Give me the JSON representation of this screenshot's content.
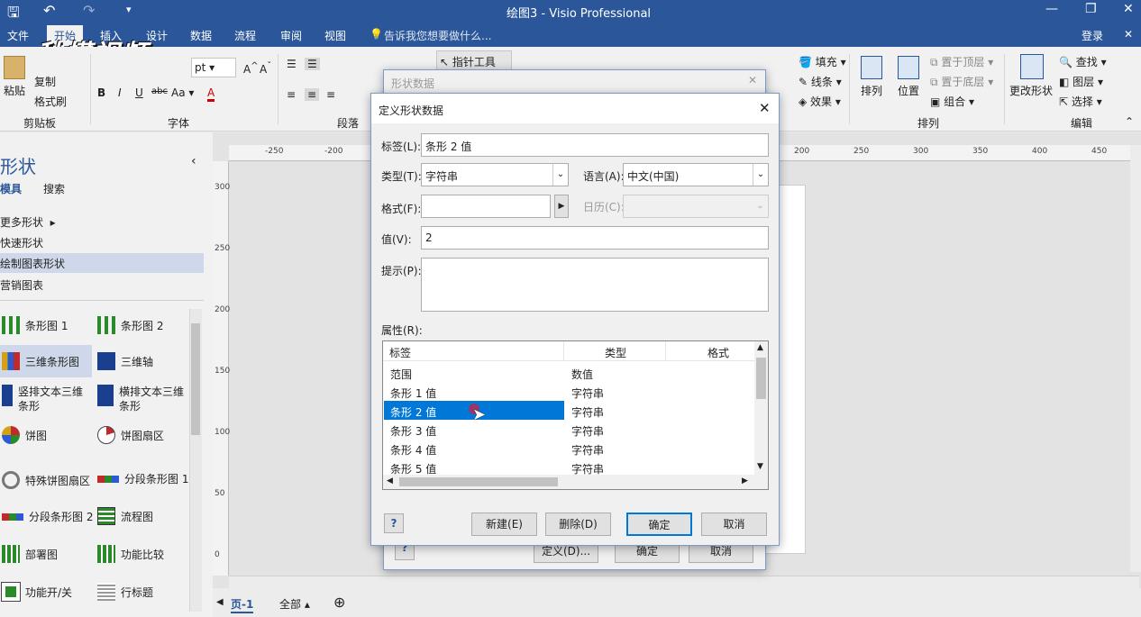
{
  "window": {
    "title": "绘图3 - Visio Professional"
  },
  "watermark": {
    "text": "秒懂视频"
  },
  "menu": {
    "items": [
      "文件",
      "开始",
      "插入",
      "设计",
      "数据",
      "流程",
      "审阅",
      "视图"
    ],
    "tell_me": "告诉我您想要做什么...",
    "login": "登录"
  },
  "ribbon": {
    "paste": "粘贴",
    "copy": "复制",
    "format_painter": "格式刷",
    "clipboard_group": "剪贴板",
    "font_size": "pt",
    "font_group": "字体",
    "paragraph_group": "段落",
    "pointer_tool": "指针工具",
    "fill": "填充",
    "line": "线条",
    "effect": "效果",
    "arrange": "排列",
    "position": "位置",
    "bring_front": "置于顶层",
    "send_back": "置于底层",
    "group": "组合",
    "arrange_group": "排列",
    "change_shape": "更改形状",
    "find": "查找",
    "layers": "图层",
    "select": "选择",
    "edit_group": "编辑"
  },
  "shapes_panel": {
    "title": "形状",
    "tab_stencils": "模具",
    "tab_search": "搜索",
    "more_shapes": "更多形状",
    "quick_shapes": "快速形状",
    "chart_shapes": "绘制图表形状",
    "marketing": "营销图表",
    "items": [
      "条形图 1",
      "条形图 2",
      "三维条形图",
      "三维轴",
      "竖排文本三维条形",
      "横排文本三维条形",
      "饼图",
      "饼图扇区",
      "特殊饼图扇区",
      "分段条形图 1",
      "分段条形图 2",
      "流程图",
      "部署图",
      "功能比较",
      "功能开/关",
      "行标题"
    ]
  },
  "ruler": {
    "h_ticks": [
      "-250",
      "-200",
      "200",
      "250",
      "300",
      "350",
      "400",
      "450"
    ],
    "v_ticks": [
      "300",
      "250",
      "200",
      "150",
      "100",
      "50",
      "0"
    ]
  },
  "status": {
    "page": "页-1",
    "all": "全部"
  },
  "back_dialog": {
    "title": "形状数据",
    "define": "定义(D)...",
    "ok": "确定",
    "cancel": "取消"
  },
  "dialog": {
    "title": "定义形状数据",
    "label_label": "标签(L):",
    "label_value": "条形 2 值",
    "type_label": "类型(T):",
    "type_value": "字符串",
    "lang_label": "语言(A):",
    "lang_value": "中文(中国)",
    "format_label": "格式(F):",
    "format_value": "",
    "calendar_label": "日历(C):",
    "value_label": "值(V):",
    "value_value": "2",
    "prompt_label": "提示(P):",
    "props_label": "属性(R):",
    "table": {
      "headers": [
        "标签",
        "类型",
        "格式"
      ],
      "rows": [
        {
          "label": "范围",
          "type": "数值"
        },
        {
          "label": "条形 1 值",
          "type": "字符串"
        },
        {
          "label": "条形 2 值",
          "type": "字符串"
        },
        {
          "label": "条形 3 值",
          "type": "字符串"
        },
        {
          "label": "条形 4 值",
          "type": "字符串"
        },
        {
          "label": "条形 5 值",
          "type": "字符串"
        }
      ]
    },
    "new_btn": "新建(E)",
    "delete_btn": "删除(D)",
    "ok_btn": "确定",
    "cancel_btn": "取消"
  },
  "colors": {
    "accent": "#2b579a",
    "selection": "#0078d7"
  }
}
